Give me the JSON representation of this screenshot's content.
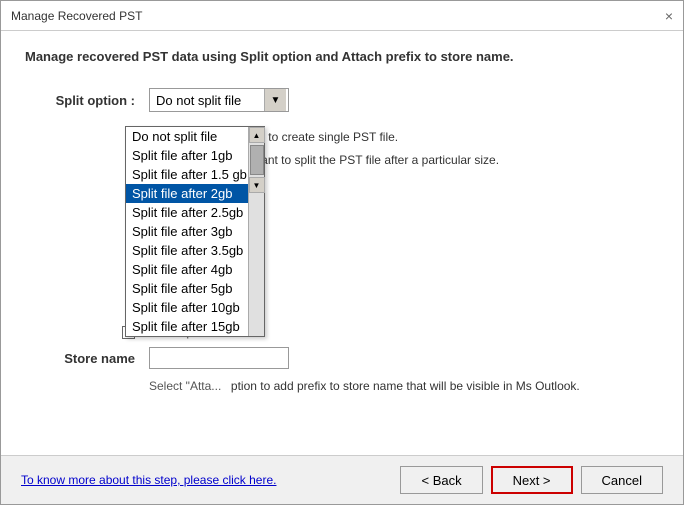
{
  "window": {
    "title": "Manage Recovered PST",
    "close_label": "×"
  },
  "description": "Manage recovered PST data using Split option and Attach prefix to store name.",
  "split_option": {
    "label": "Split option :",
    "current_value": "Do not split file",
    "options": [
      "Do not split file",
      "Split file after 1gb",
      "Split file after 1.5 gb",
      "Split file after 2gb",
      "Split file after 2.5gb",
      "Split file after 3gb",
      "Split file after 3.5gb",
      "Split file after 4gb",
      "Split file after 5gb",
      "Split file after 10gb",
      "Split file after 15gb"
    ],
    "selected_index": 3
  },
  "info_text_1": "Select \"Do not split...\" if you want to create single PST file.",
  "info_text_2": "Select other PST split option if you want to split the PST file after a particular size.",
  "attach_prefix": {
    "checkbox_label": "Attach prefix t",
    "store_name_label": "Store name",
    "store_name_value": ""
  },
  "info_text_3": "Select \"Atta..\" option to add prefix to store name that will be visible in Ms Outlook.",
  "footer": {
    "link_text": "To know more about this step, please click here.",
    "back_label": "< Back",
    "next_label": "Next >",
    "cancel_label": "Cancel"
  }
}
